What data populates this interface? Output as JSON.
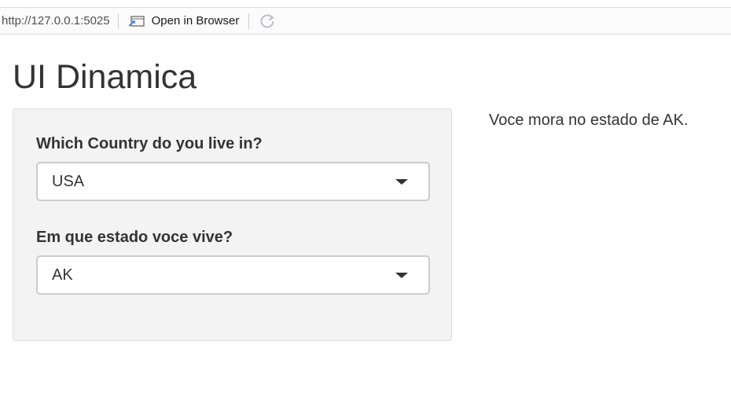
{
  "toolbar": {
    "url": "http://127.0.0.1:5025",
    "open_browser_label": "Open in Browser"
  },
  "page": {
    "title": "UI Dinamica"
  },
  "form": {
    "country_label": "Which Country do you live in?",
    "country_value": "USA",
    "state_label": "Em que estado voce vive?",
    "state_value": "AK"
  },
  "output": {
    "text": "Voce mora no estado de AK."
  },
  "icons": [
    "open-in-browser-icon",
    "refresh-icon",
    "chevron-down-icon"
  ]
}
